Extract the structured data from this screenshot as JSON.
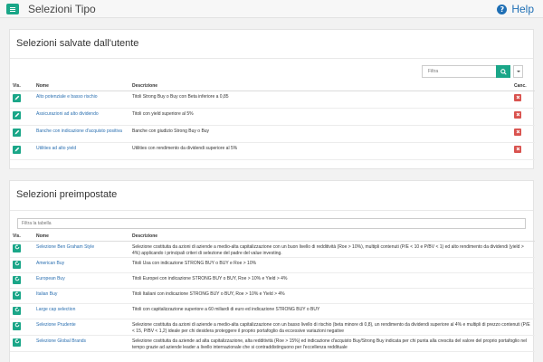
{
  "header": {
    "title": "Selezioni Tipo",
    "help_label": "Help"
  },
  "user_panel": {
    "title": "Selezioni salvate dall'utente",
    "filter_placeholder": "Filtra",
    "columns": {
      "vis": "Vis.",
      "nome": "Nome",
      "descrizione": "Descrizione",
      "canc": "Canc."
    },
    "rows": [
      {
        "nome": "Alto potenziale e basso rischio",
        "descrizione": "Titoli Strong Buy o Buy con Beta inferiore a 0,85"
      },
      {
        "nome": "Assicurazioni ad alto dividendo",
        "descrizione": "Titoli con yield superiore al 5%"
      },
      {
        "nome": "Banche con indicazione d'acquisto positiva",
        "descrizione": "Banche con giudizio Strong Buy o Buy"
      },
      {
        "nome": "Utilities ad alto yield",
        "descrizione": "Utilities con rendimento da dividendi superiore al 5%"
      }
    ]
  },
  "preset_panel": {
    "title": "Selezioni preimpostate",
    "filter_placeholder": "Filtra la tabella",
    "columns": {
      "vis": "Vis.",
      "nome": "Nome",
      "descrizione": "Descrizione"
    },
    "rows": [
      {
        "nome": "Selezione Ben Graham Style",
        "descrizione": "Selezione costituita da azioni di aziende a medio-alta capitalizzazione con un buon livello di redditività (Roe > 10%), multipli contenuti (P/E < 10 e P/BV < 1) ed alto rendimento da dividendi (yield > 4%) applicando i principali criteri di selezione del padre del value investing."
      },
      {
        "nome": "American Buy",
        "descrizione": "Titoli Usa con indicazione STRONG BUY o BUY e Roe > 10%"
      },
      {
        "nome": "European Buy",
        "descrizione": "Titoli Europei con indicazione STRONG BUY o BUY, Roe > 10% e Yield > 4%"
      },
      {
        "nome": "Italian Buy",
        "descrizione": "Titoli Italiani con indicazione STRONG BUY o BUY, Roe > 10% e Yield > 4%"
      },
      {
        "nome": "Large cap selection",
        "descrizione": "Titoli con capitalizzazione superiore a 60 miliardi di euro ed indicazione STRONG BUY o BUY"
      },
      {
        "nome": "Selezione Prudente",
        "descrizione": "Selezione costituita da azioni di aziende a medio-alta capitalizzazione con un basso livello di rischio (beta minore di 0,8), un rendimento da dividendi superiore al 4% e multipli di prezzo contenuti (P/E < 15, P/BV < 1,2) ideale per chi desidera proteggere il proprio portafoglio da eccessive variazioni negative"
      },
      {
        "nome": "Selezione Global Brands",
        "descrizione": "Selezione costituita da aziende ad alta capitalizzazione, alta redditività (Roe > 15%) ed indicazione d'acquisto Buy/Strong Buy indicata per chi punta alla crescita del valore del proprio portafoglio nel tempo grazie ad aziende leader a livello internazionale che si contraddistinguono per l'eccellenza reddituale"
      }
    ]
  },
  "colors": {
    "accent": "#1aa688",
    "link": "#2a6fb0",
    "danger": "#d9534f",
    "help": "#1f6fb5"
  },
  "icons": {
    "menu": "hamburger-icon",
    "help": "question-circle-icon",
    "search": "search-icon",
    "edit": "pencil-icon",
    "delete": "times-icon",
    "load": "refresh-icon"
  }
}
